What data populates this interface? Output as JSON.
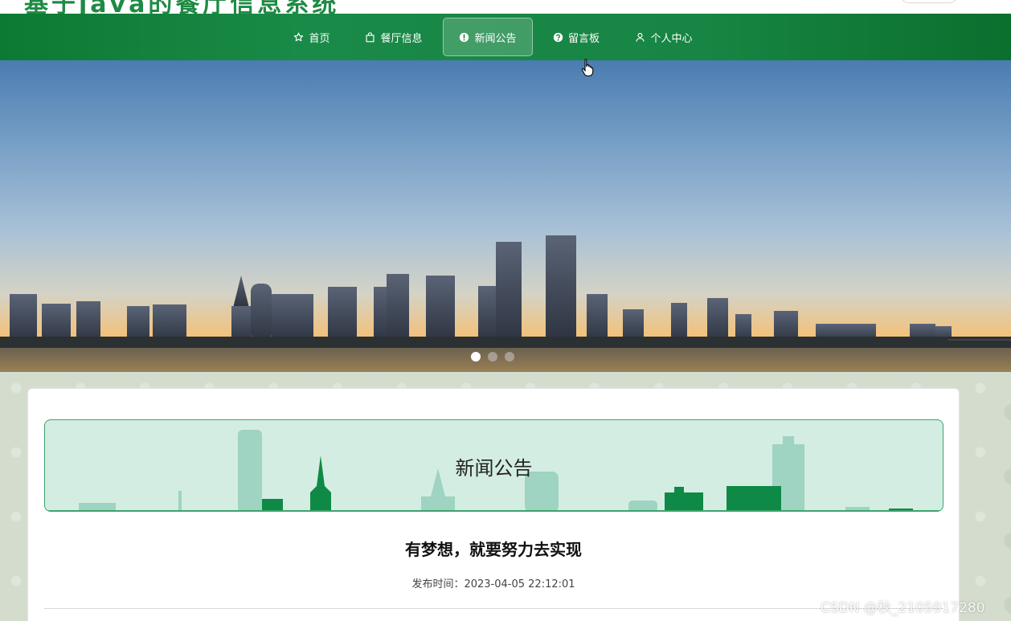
{
  "header": {
    "site_title_partial": "基于java的餐厅信息系统",
    "nav": [
      {
        "label": "首页",
        "icon": "star-icon",
        "active": false
      },
      {
        "label": "餐厅信息",
        "icon": "shopping-bag-icon",
        "active": false
      },
      {
        "label": "新闻公告",
        "icon": "exclamation-circle-icon",
        "active": true
      },
      {
        "label": "留言板",
        "icon": "question-circle-icon",
        "active": false
      },
      {
        "label": "个人中心",
        "icon": "user-icon",
        "active": false
      }
    ]
  },
  "banner": {
    "slides_count": 3,
    "active_slide": 1
  },
  "section": {
    "title": "新闻公告"
  },
  "article": {
    "title": "有梦想，就要努力去实现",
    "publish_label": "发布时间：",
    "publish_time": "2023-04-05 22:12:01"
  },
  "watermark": "CSDN @秋_2105917280",
  "colors": {
    "nav_green": "#178543",
    "accent_green": "#3da36b",
    "section_bg": "#d4ede2"
  }
}
